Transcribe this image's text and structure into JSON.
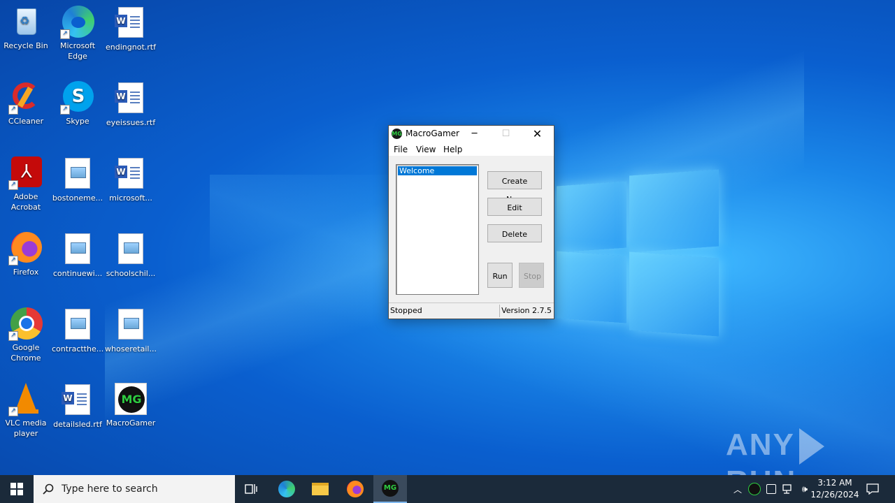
{
  "desktop": {
    "icons": [
      {
        "label": "Recycle Bin"
      },
      {
        "label": "Microsoft Edge"
      },
      {
        "label": "endingnot.rtf"
      },
      {
        "label": "CCleaner"
      },
      {
        "label": "Skype"
      },
      {
        "label": "eyeissues.rtf"
      },
      {
        "label": "Adobe Acrobat"
      },
      {
        "label": "bostoneme..."
      },
      {
        "label": "microsoft..."
      },
      {
        "label": "Firefox"
      },
      {
        "label": "continuewi..."
      },
      {
        "label": "schoolschil..."
      },
      {
        "label": "Google Chrome"
      },
      {
        "label": "contractthe..."
      },
      {
        "label": "whoseretail..."
      },
      {
        "label": "VLC media player"
      },
      {
        "label": "detailsled.rtf"
      },
      {
        "label": "MacroGamer"
      }
    ]
  },
  "window": {
    "title": "MacroGamer",
    "icon_text": "MG",
    "menu": [
      "File",
      "View",
      "Help"
    ],
    "list_items": [
      "Welcome"
    ],
    "buttons": {
      "create_new": "Create New",
      "edit": "Edit",
      "delete": "Delete",
      "run": "Run",
      "stop": "Stop"
    },
    "status": "Stopped",
    "version": "Version 2.7.5"
  },
  "taskbar": {
    "search_placeholder": "Type here to search",
    "time": "3:12 AM",
    "date": "12/26/2024"
  },
  "watermark": {
    "left": "ANY",
    "right": "RUN"
  },
  "colors": {
    "accent": "#0078d7",
    "taskbar": "#1b2a3a"
  }
}
